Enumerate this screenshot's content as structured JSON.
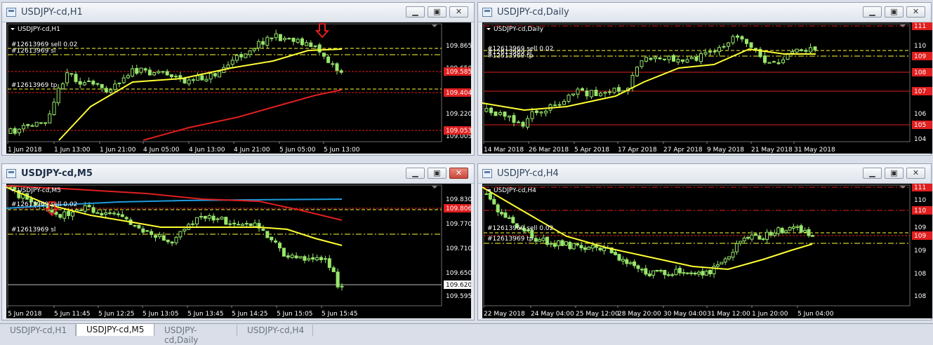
{
  "windows": [
    {
      "id": "h1",
      "title": "USDJPY-cd,H1",
      "chart_label": "USDJPY-cd,H1",
      "order_labels": [
        "#12613969 sell 0.02",
        "#12613969 sl",
        "#12613969 tp"
      ],
      "price_labels": [
        "109.865",
        "109.650",
        "109.435",
        "109.220",
        "109.005"
      ],
      "tag_labels": [
        "109.585",
        "109.404",
        "109.053"
      ],
      "time_labels": [
        "1 Jun 2018",
        "1 Jun 13:00",
        "1 Jun 21:00",
        "4 Jun 05:00",
        "4 Jun 13:00",
        "4 Jun 21:00",
        "5 Jun 05:00",
        "5 Jun 13:00"
      ],
      "buttons": {
        "minimize": "▁",
        "maximize": "▣",
        "close": "✕"
      }
    },
    {
      "id": "daily",
      "title": "USDJPY-cd,Daily",
      "chart_label": "USDJPY-cd,Daily",
      "order_labels": [
        "#12613969 sell 0.02",
        "#12613969 sl",
        "#12613969 tp"
      ],
      "price_labels": [
        "110",
        "109",
        "106",
        "104"
      ],
      "tag_labels": [
        "111",
        "109",
        "108",
        "107",
        "105"
      ],
      "time_labels": [
        "14 Mar 2018",
        "26 Mar 2018",
        "5 Apr 2018",
        "17 Apr 2018",
        "27 Apr 2018",
        "9 May 2018",
        "21 May 2018",
        "31 May 2018"
      ],
      "buttons": {
        "minimize": "▁",
        "maximize": "▣",
        "close": "✕"
      }
    },
    {
      "id": "m5",
      "title": "USDJPY-cd,M5",
      "chart_label": "USDJPY-cd,M5",
      "order_labels": [
        "#12613969 sell 0.02",
        "#12613969 sl"
      ],
      "price_labels": [
        "109.830",
        "109.770",
        "109.710",
        "109.650",
        "109.595"
      ],
      "tag_labels": [
        "109.806",
        "109.620"
      ],
      "time_labels": [
        "5 Jun 2018",
        "5 Jun 11:45",
        "5 Jun 12:25",
        "5 Jun 13:05",
        "5 Jun 13:45",
        "5 Jun 14:25",
        "5 Jun 15:05",
        "5 Jun 15:45"
      ],
      "buttons": {
        "minimize": "▁",
        "maximize": "▣",
        "close": "✕"
      }
    },
    {
      "id": "h4",
      "title": "USDJPY-cd,H4",
      "chart_label": "USDJPY-cd,H4",
      "order_labels": [
        "#12613969 sell 0.02",
        "#12613969 tp"
      ],
      "price_labels": [
        "110",
        "109",
        "109",
        "108",
        "108"
      ],
      "tag_labels": [
        "111",
        "110",
        "109"
      ],
      "time_labels": [
        "22 May 2018",
        "24 May 04:00",
        "25 May 12:00",
        "28 May 20:00",
        "30 May 04:00",
        "31 May 12:00",
        "1 Jun 20:00",
        "5 Jun 04:00"
      ],
      "buttons": {
        "minimize": "▁",
        "maximize": "▣",
        "close": "✕"
      }
    }
  ],
  "tabs": [
    "USDJPY-cd,H1",
    "USDJPY-cd,M5",
    "USDJPY-cd,Daily",
    "USDJPY-cd,H4"
  ],
  "active_tab": "USDJPY-cd,M5",
  "colors": {
    "background": "#000000",
    "bull": "#98e66b",
    "ma_fast": "#ffff33",
    "ma_slow": "#e01f1f",
    "ma_blue": "#1e9bdc",
    "grid": "#2b2b2b"
  }
}
